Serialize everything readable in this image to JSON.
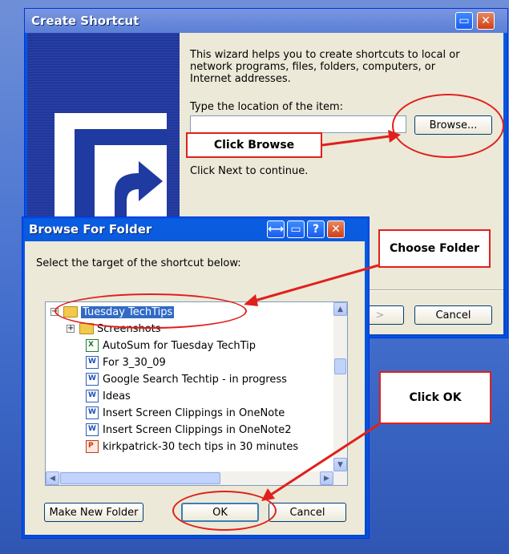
{
  "create_shortcut": {
    "title": "Create Shortcut",
    "intro": "This wizard helps you to create shortcuts to local or network programs, files, folders, computers, or Internet addresses.",
    "location_label": "Type the location of the item:",
    "location_value": "",
    "browse_label": "Browse...",
    "continue_text": "Click Next to continue.",
    "next_label": ">",
    "cancel_label": "Cancel"
  },
  "browse_dialog": {
    "title": "Browse For Folder",
    "instruction": "Select the target of the shortcut below:",
    "tree": [
      {
        "label": "Tuesday TechTips",
        "type": "folder",
        "expander": "−",
        "selected": true
      },
      {
        "label": "Screenshots",
        "type": "folder",
        "expander": "+"
      },
      {
        "label": "AutoSum for Tuesday TechTip",
        "type": "excel"
      },
      {
        "label": "For 3_30_09",
        "type": "word"
      },
      {
        "label": "Google Search Techtip - in progress",
        "type": "word"
      },
      {
        "label": "Ideas",
        "type": "word"
      },
      {
        "label": "Insert Screen Clippings in OneNote",
        "type": "word"
      },
      {
        "label": "Insert Screen Clippings in OneNote2",
        "type": "word"
      },
      {
        "label": "kirkpatrick-30 tech tips in 30 minutes",
        "type": "powerpoint"
      }
    ],
    "make_new_folder_label": "Make New Folder",
    "ok_label": "OK",
    "cancel_label": "Cancel"
  },
  "annotations": {
    "click_browse": "Click Browse",
    "choose_folder": "Choose Folder",
    "click_ok": "Click OK"
  },
  "colors": {
    "xp_blue": "#0054e3",
    "annotation_red": "#e0201c",
    "dialog_bg": "#ece9d8"
  }
}
